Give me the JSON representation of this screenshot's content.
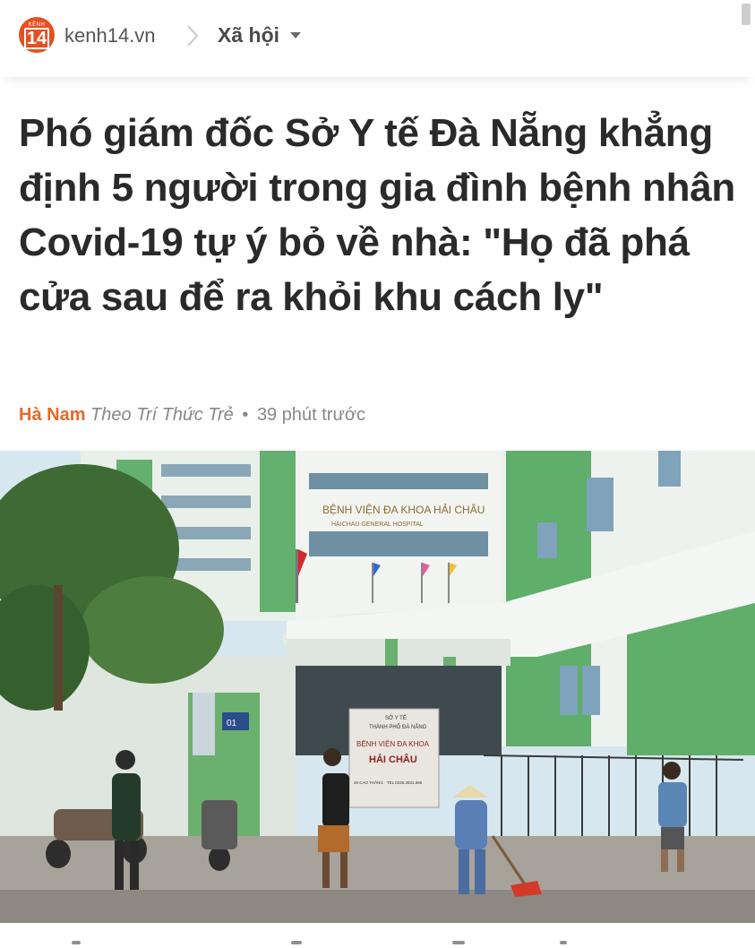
{
  "header": {
    "logo_top": "KÊNH",
    "logo_number": "14",
    "site": "kenh14.vn",
    "section": "Xã hội"
  },
  "article": {
    "title": "Phó giám đốc Sở Y tế Đà Nẵng khẳng định 5 người trong gia đình bệnh nhân Covid-19 tự ý bỏ về nhà: \"Họ đã phá cửa sau để ra khỏi khu cách ly\"",
    "author": "Hà Nam",
    "source": "Theo Trí Thức Trẻ",
    "separator": "•",
    "time": "39 phút trước"
  },
  "photo": {
    "building_banner": "BỆNH VIỆN ĐA KHOA HẢI CHÂU",
    "building_banner_sub": "HAICHAU GENERAL HOSPITAL",
    "sign_line1": "SỞ Y TẾ",
    "sign_line2": "THÀNH PHỐ ĐÀ NẴNG",
    "sign_line3": "BỆNH VIỆN ĐA KHOA",
    "sign_line4": "HẢI CHÂU",
    "sign_line5": "26 CAO THẮNG · TEL 0236.3821.696",
    "door_number": "01"
  },
  "colors": {
    "accent": "#e4692b",
    "logo": "#e4511f",
    "building_green": "#5fae6a",
    "building_white": "#eef2ee"
  },
  "icons": {
    "logo": "kenh14-logo-icon",
    "separator": "chevron-right-icon",
    "dropdown": "caret-down-icon"
  }
}
